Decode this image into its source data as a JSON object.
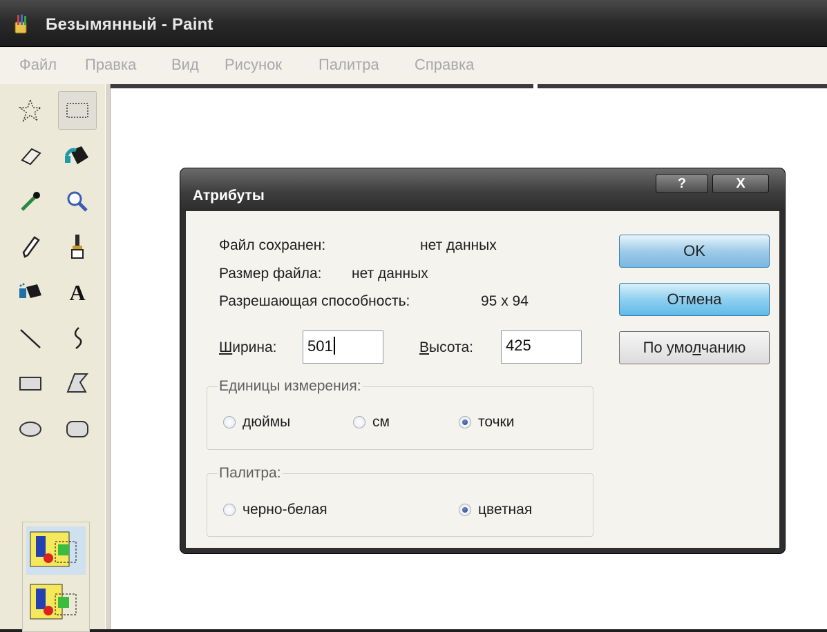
{
  "window": {
    "title": "Безымянный - Paint"
  },
  "menu": [
    {
      "label": "Файл"
    },
    {
      "label": "Правка"
    },
    {
      "label": "Вид"
    },
    {
      "label": "Рисунок"
    },
    {
      "label": "Палитра"
    },
    {
      "label": "Справка"
    }
  ],
  "toolbox": {
    "tools": [
      "free-select-icon",
      "rect-select-icon",
      "eraser-icon",
      "fill-bucket-icon",
      "color-picker-icon",
      "magnifier-icon",
      "pencil-icon",
      "brush-icon",
      "airbrush-icon",
      "text-icon",
      "line-icon",
      "curve-icon",
      "rectangle-icon",
      "polygon-icon",
      "ellipse-icon",
      "rounded-rect-icon"
    ],
    "selected_tool": "rect-select-icon",
    "text_tool_glyph": "A",
    "options": [
      "opaque-selection-icon",
      "transparent-selection-icon"
    ]
  },
  "dialog": {
    "title": "Атрибуты",
    "help_button": "?",
    "close_button": "X",
    "file_saved_label": "Файл сохранен:",
    "file_saved_value": "нет данных",
    "file_size_label": "Размер файла:",
    "file_size_value": "нет данных",
    "resolution_label": "Разрешающая способность:",
    "resolution_value": "95 x 94",
    "width_label_u": "Ш",
    "width_label_rest": "ирина:",
    "width_value": "501",
    "height_label_u": "В",
    "height_label_rest": "ысота:",
    "height_value": "425",
    "units_group": "Единицы измерения:",
    "units": [
      {
        "pre": "",
        "u": "д",
        "post": "юймы",
        "checked": false
      },
      {
        "pre": "с",
        "u": "м",
        "post": "",
        "checked": false
      },
      {
        "pre": "",
        "u": "т",
        "post": "очки",
        "checked": true
      }
    ],
    "palette_group": "Палитра:",
    "palette": [
      {
        "pre": "",
        "u": "ч",
        "post": "ерно-белая",
        "checked": false
      },
      {
        "pre": "цв",
        "u": "е",
        "post": "тная",
        "checked": true
      }
    ],
    "ok_button": "OK",
    "cancel_button": "Отмена",
    "default_button_pre": "По умо",
    "default_button_u": "л",
    "default_button_post": "чанию"
  }
}
